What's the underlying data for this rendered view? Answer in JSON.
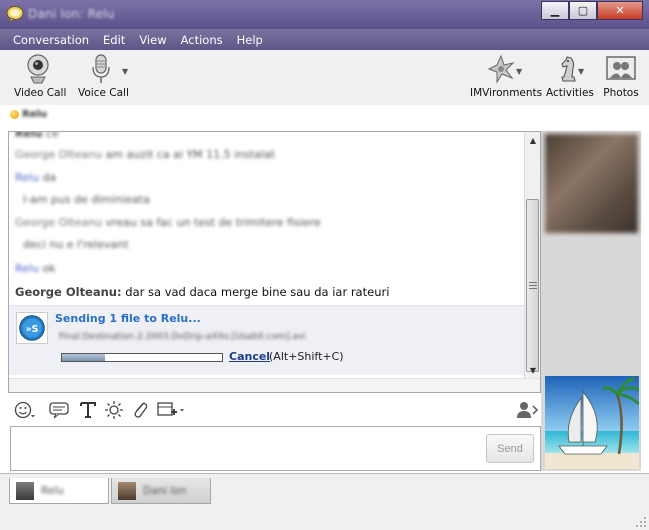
{
  "window": {
    "title": "Dani Ion: Relu",
    "controls": {
      "minimize": "▁",
      "maximize": "▢",
      "close": "✕"
    }
  },
  "menu": [
    "Conversation",
    "Edit",
    "View",
    "Actions",
    "Help"
  ],
  "toolbar": {
    "video_call": "Video Call",
    "voice_call": "Voice Call",
    "imvironments": "IMVironments",
    "activities": "Activities",
    "photos": "Photos"
  },
  "contact": {
    "name": "Relu"
  },
  "messages": [
    {
      "sender": "Relu",
      "text": "ce"
    },
    {
      "sender": "George Olteanu",
      "text": "am auzit ca ai YM 11.5 instalat"
    },
    {
      "sender": "Relu",
      "text": "da"
    },
    {
      "sender": "",
      "text": "l-am pus de diminieata"
    },
    {
      "sender": "George Olteanu",
      "text": "vreau sa fac un test de trimitere fisiere"
    },
    {
      "sender": "",
      "text": "deci nu e l'relevant"
    },
    {
      "sender": "Relu",
      "text": "ok"
    },
    {
      "sender": "George Olteanu:",
      "text": "dar sa vad daca merge bine sau da iar rateuri"
    }
  ],
  "transfer": {
    "heading": "Sending 1 file to Relu...",
    "filename": "Final.Destination.2.2003.DvDrip-aXXo.[Usabit.com].avi",
    "progress": 0.27,
    "cancel": "Cancel",
    "shortcut": "(Alt+Shift+C)"
  },
  "input": {
    "send": "Send"
  },
  "tabs": [
    {
      "name": "Relu"
    },
    {
      "name": "Dani Ion"
    }
  ]
}
